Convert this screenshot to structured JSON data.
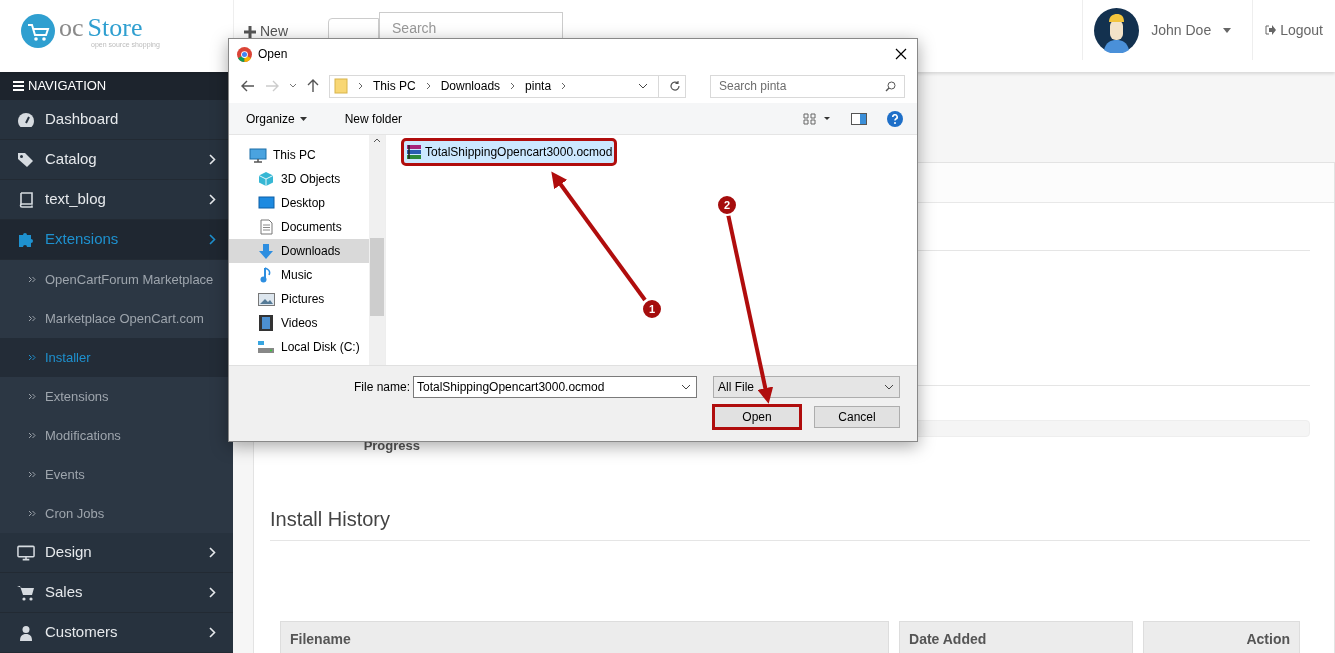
{
  "header": {
    "logo": {
      "prefix": "oc",
      "name": "Store",
      "tagline": "open source shopping"
    },
    "new_button": "New",
    "search": {
      "placeholder": "Search"
    },
    "user": "John Doe",
    "logout": "Logout"
  },
  "sidebar": {
    "title": "NAVIGATION",
    "items": [
      {
        "label": "Dashboard",
        "selected": false,
        "has_children": false
      },
      {
        "label": "Catalog",
        "selected": false,
        "has_children": true
      },
      {
        "label": "text_blog",
        "selected": false,
        "has_children": true
      },
      {
        "label": "Extensions",
        "selected": true,
        "has_children": true,
        "expanded": true,
        "children": [
          {
            "label": "OpenCartForum Marketplace",
            "selected": false
          },
          {
            "label": "Marketplace OpenCart.com",
            "selected": false
          },
          {
            "label": "Installer",
            "selected": true
          },
          {
            "label": "Extensions",
            "selected": false
          },
          {
            "label": "Modifications",
            "selected": false
          },
          {
            "label": "Events",
            "selected": false
          },
          {
            "label": "Cron Jobs",
            "selected": false
          }
        ]
      },
      {
        "label": "Design",
        "selected": false,
        "has_children": true
      },
      {
        "label": "Sales",
        "selected": false,
        "has_children": true
      },
      {
        "label": "Customers",
        "selected": false,
        "has_children": true
      }
    ]
  },
  "main": {
    "progress_label": "Progress",
    "history_title": "Install History",
    "table": {
      "columns": [
        {
          "label": "Filename"
        },
        {
          "label": "Date Added"
        },
        {
          "label": "Action"
        }
      ]
    }
  },
  "dialog": {
    "title": "Open",
    "breadcrumb": [
      "This PC",
      "Downloads",
      "pinta"
    ],
    "search_placeholder": "Search pinta",
    "toolbar": [
      "Organize",
      "New folder"
    ],
    "nav": [
      {
        "label": "This PC",
        "selected": false
      },
      {
        "label": "3D Objects",
        "selected": false
      },
      {
        "label": "Desktop",
        "selected": false
      },
      {
        "label": "Documents",
        "selected": false
      },
      {
        "label": "Downloads",
        "selected": true
      },
      {
        "label": "Music",
        "selected": false
      },
      {
        "label": "Pictures",
        "selected": false
      },
      {
        "label": "Videos",
        "selected": false
      },
      {
        "label": "Local Disk (C:)",
        "selected": false
      }
    ],
    "files": [
      {
        "name": "TotalShippingOpencart3000.ocmod",
        "selected": true,
        "highlighted": true
      }
    ],
    "file_name_label": "File name:",
    "file_name_value": "TotalShippingOpencart3000.ocmod",
    "file_type": "All File",
    "buttons": [
      {
        "label": "Open",
        "highlighted": true
      },
      {
        "label": "Cancel",
        "highlighted": false
      }
    ]
  },
  "annotations": [
    {
      "number": "1"
    },
    {
      "number": "2"
    }
  ]
}
